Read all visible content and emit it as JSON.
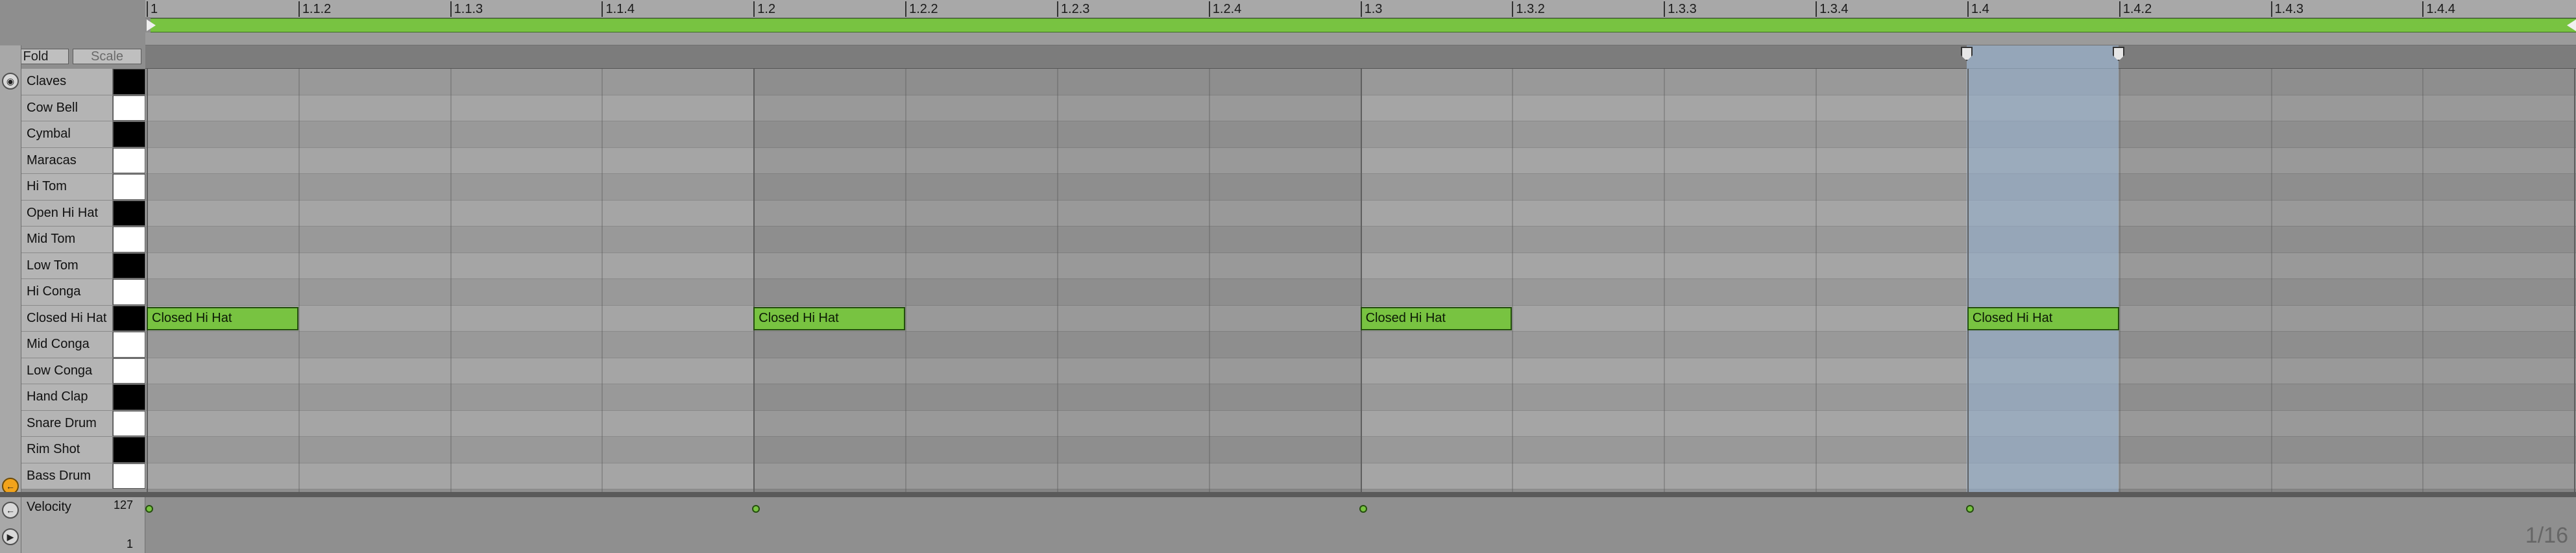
{
  "header": {
    "fold_label": "Fold",
    "scale_label": "Scale"
  },
  "ruler": {
    "labels": [
      "1",
      "1.1.2",
      "1.1.3",
      "1.1.4",
      "1.2",
      "1.2.2",
      "1.2.3",
      "1.2.4",
      "1.3",
      "1.3.2",
      "1.3.3",
      "1.3.4",
      "1.4",
      "1.4.2",
      "1.4.3",
      "1.4.4"
    ]
  },
  "drums": [
    {
      "name": "Claves",
      "key": "black"
    },
    {
      "name": "Cow Bell",
      "key": "white"
    },
    {
      "name": "Cymbal",
      "key": "black"
    },
    {
      "name": "Maracas",
      "key": "white"
    },
    {
      "name": "Hi Tom",
      "key": "white"
    },
    {
      "name": "Open Hi Hat",
      "key": "black"
    },
    {
      "name": "Mid Tom",
      "key": "white"
    },
    {
      "name": "Low Tom",
      "key": "black"
    },
    {
      "name": "Hi Conga",
      "key": "white"
    },
    {
      "name": "Closed Hi Hat",
      "key": "black"
    },
    {
      "name": "Mid Conga",
      "key": "white"
    },
    {
      "name": "Low Conga",
      "key": "white"
    },
    {
      "name": "Hand Clap",
      "key": "black"
    },
    {
      "name": "Snare Drum",
      "key": "white"
    },
    {
      "name": "Rim Shot",
      "key": "black"
    },
    {
      "name": "Bass Drum",
      "key": "white"
    }
  ],
  "notes": [
    {
      "label": "Closed Hi Hat",
      "row": 9,
      "start": 0,
      "length": 0.25
    },
    {
      "label": "Closed Hi Hat",
      "row": 9,
      "start": 1,
      "length": 0.25
    },
    {
      "label": "Closed Hi Hat",
      "row": 9,
      "start": 2,
      "length": 0.25
    },
    {
      "label": "Closed Hi Hat",
      "row": 9,
      "start": 3,
      "length": 0.25
    }
  ],
  "velocity": {
    "label": "Velocity",
    "max": "127",
    "min": "1",
    "values": [
      127,
      127,
      127,
      127
    ]
  },
  "grid_resolution": "1/16",
  "colors": {
    "note": "#78c341",
    "selection": "#aac8eb"
  }
}
